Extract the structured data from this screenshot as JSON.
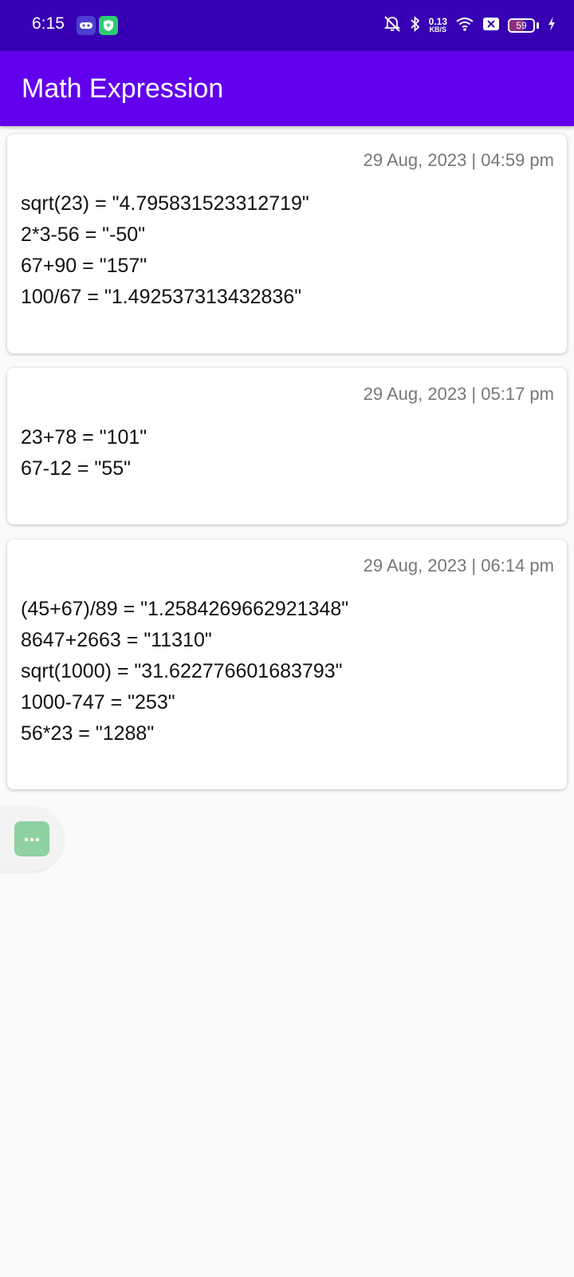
{
  "status_bar": {
    "time": "6:15",
    "net_speed_value": "0.13",
    "net_speed_unit": "KB/S",
    "battery_level": "59"
  },
  "app_bar": {
    "title": "Math Expression"
  },
  "cards": [
    {
      "date": "29 Aug, 2023 | 04:59 pm",
      "lines": [
        "sqrt(23) = \"4.795831523312719\"",
        "2*3-56 = \"-50\"",
        "67+90 = \"157\"",
        "100/67 = \"1.492537313432836\""
      ]
    },
    {
      "date": "29 Aug, 2023 | 05:17 pm",
      "lines": [
        "23+78 = \"101\"",
        "67-12 = \"55\""
      ]
    },
    {
      "date": "29 Aug, 2023 | 06:14 pm",
      "lines": [
        "(45+67)/89 = \"1.2584269662921348\"",
        "8647+2663 = \"11310\"",
        "sqrt(1000) = \"31.622776601683793\"",
        "1000-747 = \"253\"",
        "56*23 = \"1288\""
      ]
    }
  ],
  "floating_button": {
    "icon": "more-dots-icon"
  },
  "colors": {
    "status_bar": "#3700b3",
    "app_bar": "#6200ee",
    "fab": "#8fd1a0"
  }
}
